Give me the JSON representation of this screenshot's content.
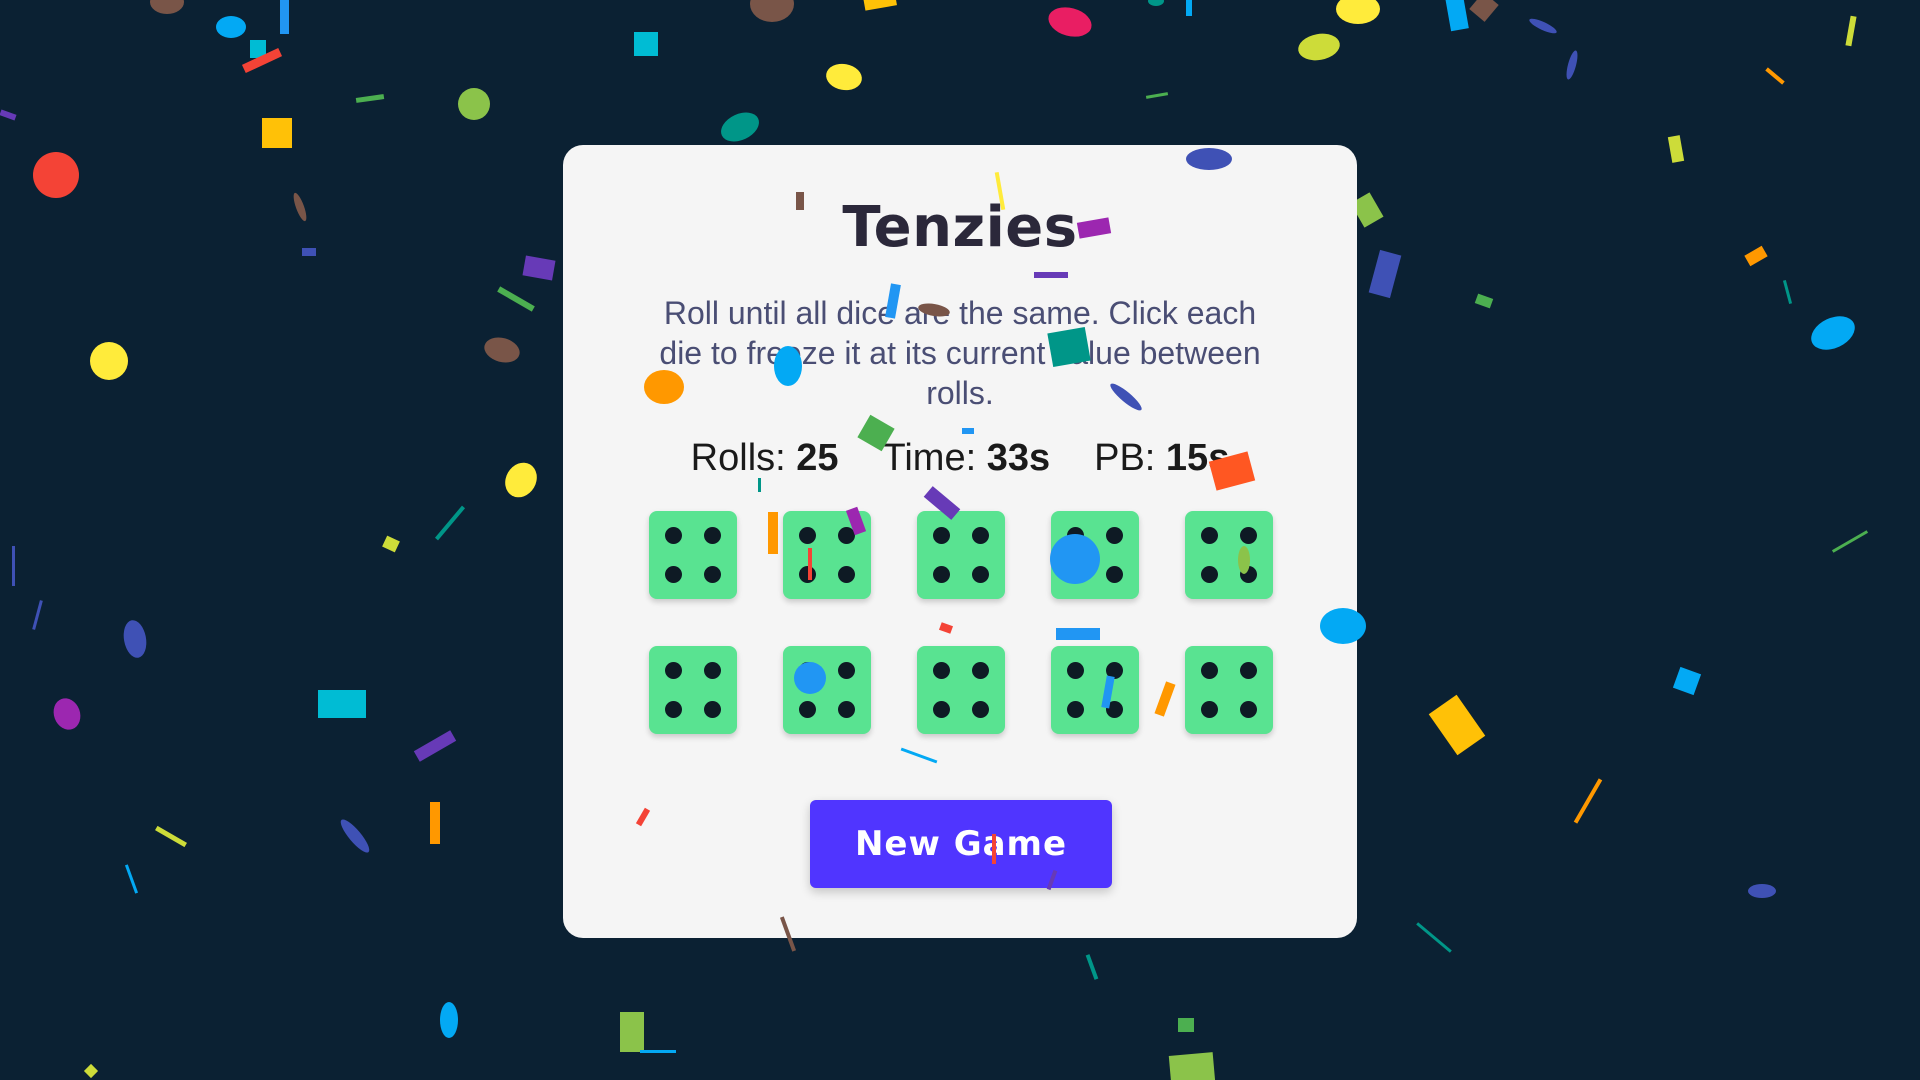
{
  "game": {
    "title": "Tenzies",
    "instructions": "Roll until all dice are the same. Click each die to freeze it at its current value between rolls.",
    "stats": {
      "rolls_label": "Rolls:",
      "rolls_value": "25",
      "time_label": "Time:",
      "time_value": "33s",
      "pb_label": "PB:",
      "pb_value": "15s"
    },
    "dice": [
      {
        "value": 4,
        "held": true
      },
      {
        "value": 4,
        "held": true
      },
      {
        "value": 4,
        "held": true
      },
      {
        "value": 4,
        "held": true
      },
      {
        "value": 4,
        "held": true
      },
      {
        "value": 4,
        "held": true
      },
      {
        "value": 4,
        "held": true
      },
      {
        "value": 4,
        "held": true
      },
      {
        "value": 4,
        "held": true
      },
      {
        "value": 4,
        "held": true
      }
    ],
    "new_game_label": "New Game",
    "state": "won"
  },
  "colors": {
    "background": "#0b2133",
    "panel": "#f5f5f5",
    "die_held": "#59e391",
    "pip": "#0e1a24",
    "button": "#5035ff",
    "title": "#2b283a",
    "instructions": "#4a4e74"
  },
  "confetti_colors": [
    "#f44336",
    "#e91e63",
    "#9c27b0",
    "#673ab7",
    "#3f51b5",
    "#2196f3",
    "#03a9f4",
    "#00bcd4",
    "#009688",
    "#4caf50",
    "#8bc34a",
    "#cddc39",
    "#ffeb3b",
    "#ffc107",
    "#ff9800",
    "#ff5722",
    "#795548"
  ]
}
